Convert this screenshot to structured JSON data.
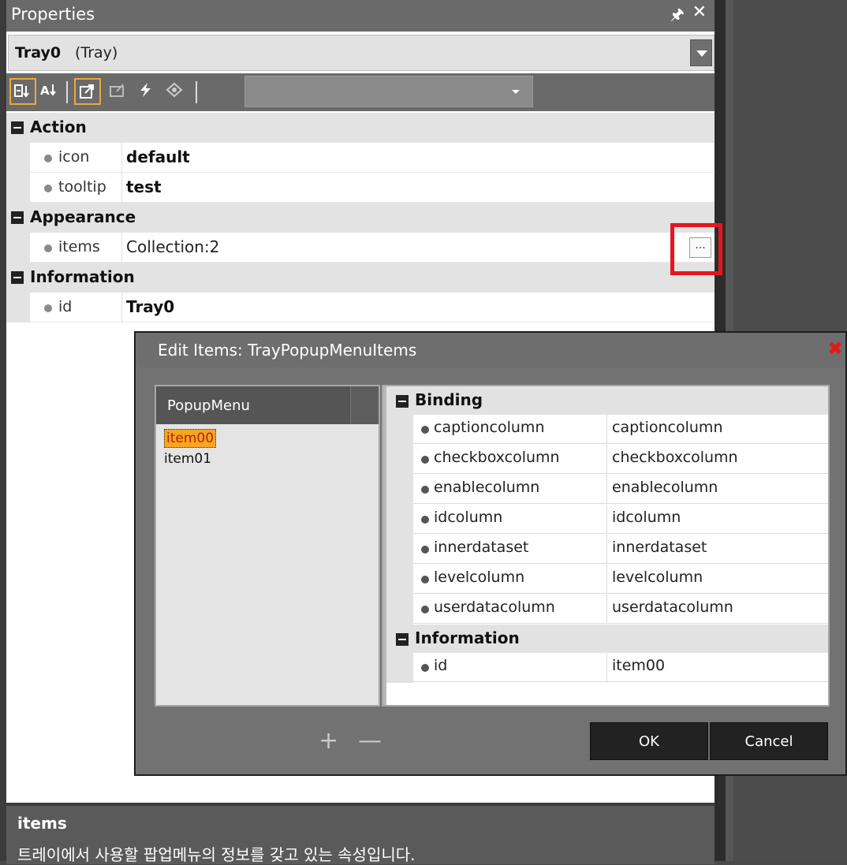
{
  "properties": {
    "title": "Properties",
    "pin_icon": "pin-icon",
    "close_icon": "close-icon",
    "object": {
      "name": "Tray0",
      "type": "(Tray)"
    },
    "toolbar": {
      "buttons": [
        "categorized-icon",
        "alphabetical-icon",
        "properties-icon",
        "inherited-icon",
        "events-icon",
        "edit-icon"
      ]
    },
    "categories": [
      {
        "label": "Action",
        "rows": [
          {
            "name": "icon",
            "value": "default"
          },
          {
            "name": "tooltip",
            "value": "test"
          }
        ]
      },
      {
        "label": "Appearance",
        "rows": [
          {
            "name": "items",
            "value": "Collection:2"
          }
        ]
      },
      {
        "label": "Information",
        "rows": [
          {
            "name": "id",
            "value": "Tray0"
          }
        ]
      }
    ],
    "ellipsis_label": "...",
    "description": {
      "heading": "items",
      "text": "트레이에서 사용할 팝업메뉴의 정보를 갖고 있는 속성입니다."
    }
  },
  "dialog": {
    "title": "Edit Items: TrayPopupMenuItems",
    "list_header": "PopupMenu",
    "items": [
      "item00",
      "item01"
    ],
    "categories": [
      {
        "label": "Binding",
        "rows": [
          {
            "name": "captioncolumn",
            "value": "captioncolumn"
          },
          {
            "name": "checkboxcolumn",
            "value": "checkboxcolumn"
          },
          {
            "name": "enablecolumn",
            "value": "enablecolumn"
          },
          {
            "name": "idcolumn",
            "value": "idcolumn"
          },
          {
            "name": "innerdataset",
            "value": "innerdataset"
          },
          {
            "name": "levelcolumn",
            "value": "levelcolumn"
          },
          {
            "name": "userdatacolumn",
            "value": "userdatacolumn"
          }
        ]
      },
      {
        "label": "Information",
        "rows": [
          {
            "name": "id",
            "value": "item00"
          }
        ]
      }
    ],
    "add_label": "+",
    "remove_label": "—",
    "ok_label": "OK",
    "cancel_label": "Cancel"
  },
  "colors": {
    "highlight": "#e8141e",
    "selected_item": "#f5a623",
    "close_red": "#e01b1b"
  }
}
